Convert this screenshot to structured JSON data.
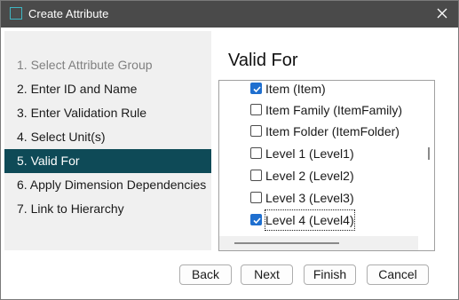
{
  "window": {
    "title": "Create Attribute"
  },
  "steps": [
    {
      "label": "1. Select Attribute Group",
      "state": "disabled"
    },
    {
      "label": "2. Enter ID and Name",
      "state": "normal"
    },
    {
      "label": "3. Enter Validation Rule",
      "state": "normal"
    },
    {
      "label": "4. Select Unit(s)",
      "state": "normal"
    },
    {
      "label": "5. Valid For",
      "state": "active"
    },
    {
      "label": "6. Apply Dimension Dependencies",
      "state": "normal"
    },
    {
      "label": "7. Link to Hierarchy",
      "state": "normal"
    }
  ],
  "main": {
    "heading": "Valid For",
    "items": [
      {
        "label": "Item (Item)",
        "checked": true
      },
      {
        "label": "Item Family (ItemFamily)",
        "checked": false
      },
      {
        "label": "Item Folder (ItemFolder)",
        "checked": false
      },
      {
        "label": "Level 1 (Level1)",
        "checked": false
      },
      {
        "label": "Level 2 (Level2)",
        "checked": false
      },
      {
        "label": "Level 3 (Level3)",
        "checked": false
      },
      {
        "label": "Level 4 (Level4)",
        "checked": true
      }
    ]
  },
  "buttons": {
    "back": "Back",
    "next": "Next",
    "finish": "Finish",
    "cancel": "Cancel"
  },
  "colors": {
    "titlebar": "#4a4a4a",
    "active_step": "#0e4a57",
    "checkbox_checked": "#1f6fcf",
    "app_icon": "#3fb6c2"
  }
}
